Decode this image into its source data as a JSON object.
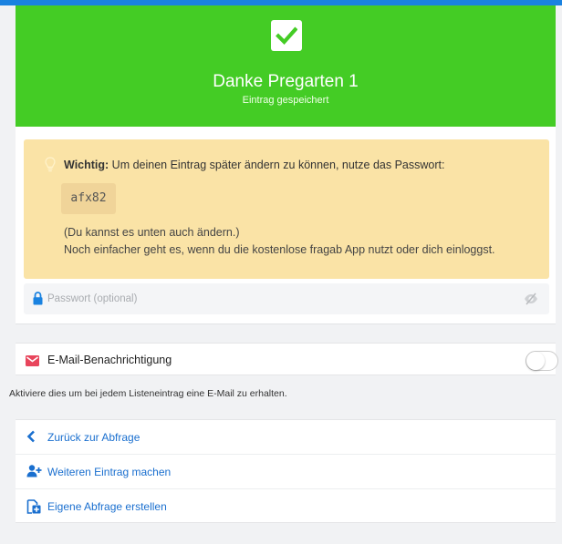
{
  "colors": {
    "topbar": "#1a82e0",
    "success": "#44cc25",
    "warning_bg": "#fae3a6",
    "link": "#1a6fcf",
    "mail_icon": "#e8455c"
  },
  "hero": {
    "icon": "checkmark-icon",
    "title": "Danke Pregarten 1",
    "subtitle": "Eintrag gespeichert"
  },
  "notice": {
    "icon": "lightbulb-icon",
    "label": "Wichtig:",
    "text": " Um deinen Eintrag später ändern zu können, nutze das Passwort:",
    "password": "afx82",
    "note1": "(Du kannst es unten auch ändern.)",
    "note2": "Noch einfacher geht es, wenn du die kostenlose fragab App nutzt oder dich einloggst."
  },
  "password_field": {
    "icon": "lock-icon",
    "placeholder": "Passwort (optional)",
    "value": "",
    "toggle_icon": "eye-slash-icon"
  },
  "email_notification": {
    "icon": "envelope-icon",
    "label": "E-Mail-Benachrichtigung",
    "enabled": false,
    "help": "Aktiviere dies um bei jedem Listeneintrag eine E-Mail zu erhalten."
  },
  "links": [
    {
      "icon": "chevron-left-icon",
      "label": "Zurück zur Abfrage"
    },
    {
      "icon": "user-plus-icon",
      "label": "Weiteren Eintrag machen"
    },
    {
      "icon": "file-plus-icon",
      "label": "Eigene Abfrage erstellen"
    }
  ]
}
